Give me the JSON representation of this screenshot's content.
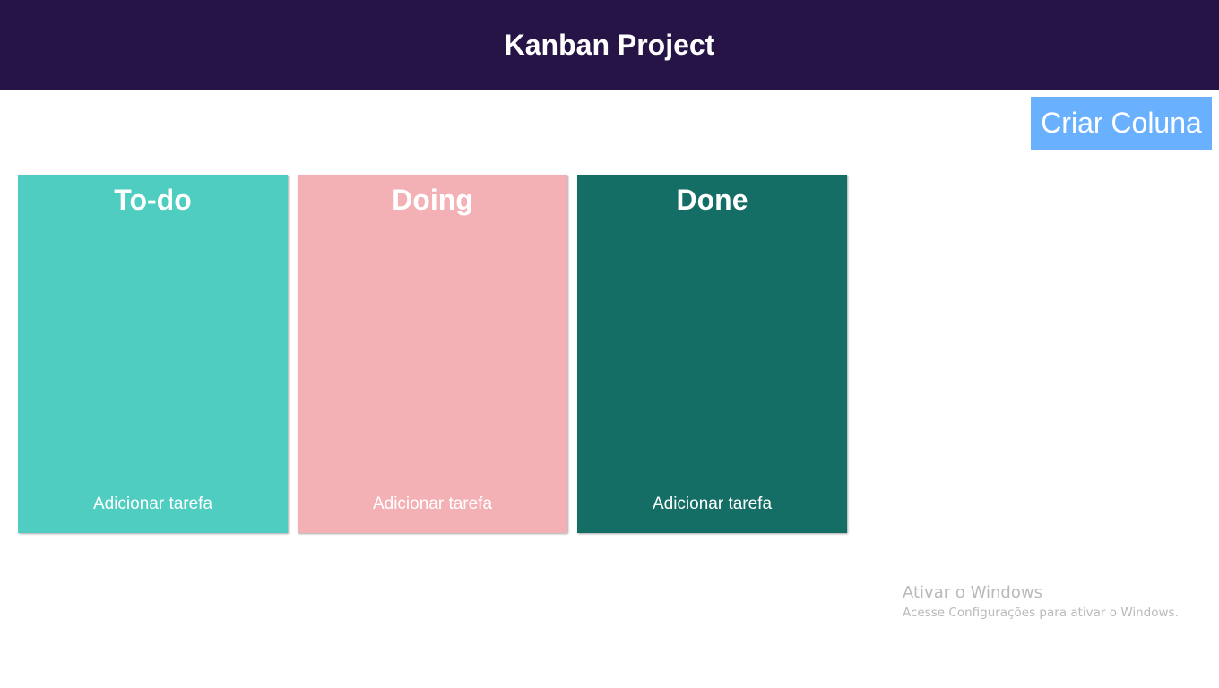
{
  "header": {
    "title": "Kanban Project",
    "background": "#261447"
  },
  "toolbar": {
    "create_column_label": "Criar Coluna",
    "create_column_color": "#69b1ff"
  },
  "columns": [
    {
      "title": "To-do",
      "add_task_label": "Adicionar tarefa",
      "color": "#4ecdc0"
    },
    {
      "title": "Doing",
      "add_task_label": "Adicionar tarefa",
      "color": "#f3b0b5"
    },
    {
      "title": "Done",
      "add_task_label": "Adicionar tarefa",
      "color": "#146e65"
    }
  ],
  "watermark": {
    "title": "Ativar o Windows",
    "subtitle": "Acesse Configurações para ativar o Windows."
  }
}
